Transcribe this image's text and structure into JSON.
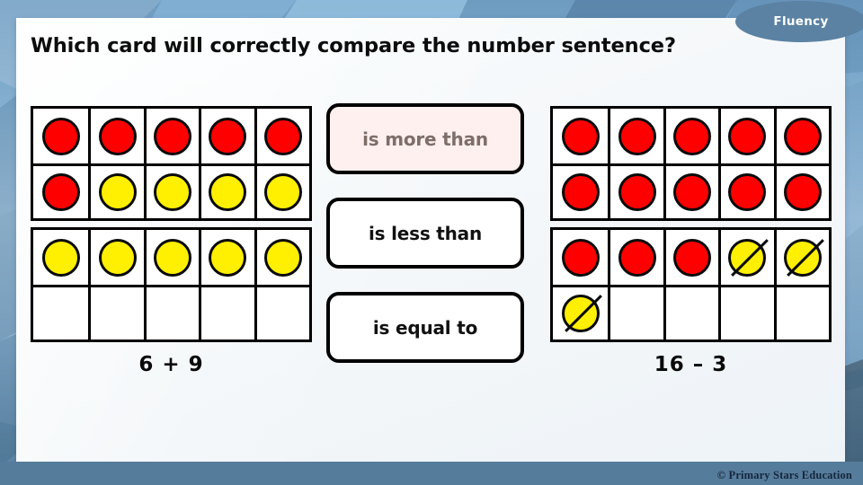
{
  "badge": {
    "label": "Fluency"
  },
  "header": {
    "title": "Which card will correctly compare the number sentence?"
  },
  "footer": {
    "credit": "© Primary Stars Education"
  },
  "colors": {
    "red_counter": "#FF0000",
    "yellow_counter": "#FFEF00",
    "badge_blue": "#5B82A3",
    "band_blue": "#567C9B",
    "highlight_card_bg": "#FDF0EE",
    "highlight_card_text": "#7D6E69"
  },
  "left_side": {
    "name": "left-ten-frames",
    "sentence": "6 + 9",
    "total_counters": 15,
    "frames": [
      {
        "rows": [
          [
            "red",
            "red",
            "red",
            "red",
            "red"
          ],
          [
            "red",
            "yellow",
            "yellow",
            "yellow",
            "yellow"
          ]
        ]
      },
      {
        "rows": [
          [
            "yellow",
            "yellow",
            "yellow",
            "yellow",
            "yellow"
          ],
          [
            "empty",
            "empty",
            "empty",
            "empty",
            "empty"
          ]
        ]
      }
    ]
  },
  "right_side": {
    "name": "right-ten-frames",
    "sentence": "16 – 3",
    "total_counters": 16,
    "crossed_out": 3,
    "frames": [
      {
        "rows": [
          [
            "red",
            "red",
            "red",
            "red",
            "red"
          ],
          [
            "red",
            "red",
            "red",
            "red",
            "red"
          ]
        ]
      },
      {
        "rows": [
          [
            "red",
            "red",
            "red",
            "yellow-crossed",
            "yellow-crossed"
          ],
          [
            "yellow-crossed",
            "empty",
            "empty",
            "empty",
            "empty"
          ]
        ]
      }
    ]
  },
  "answer_cards": [
    {
      "label": "is more than",
      "highlighted": true
    },
    {
      "label": "is less than",
      "highlighted": false
    },
    {
      "label": "is equal to",
      "highlighted": false
    }
  ]
}
